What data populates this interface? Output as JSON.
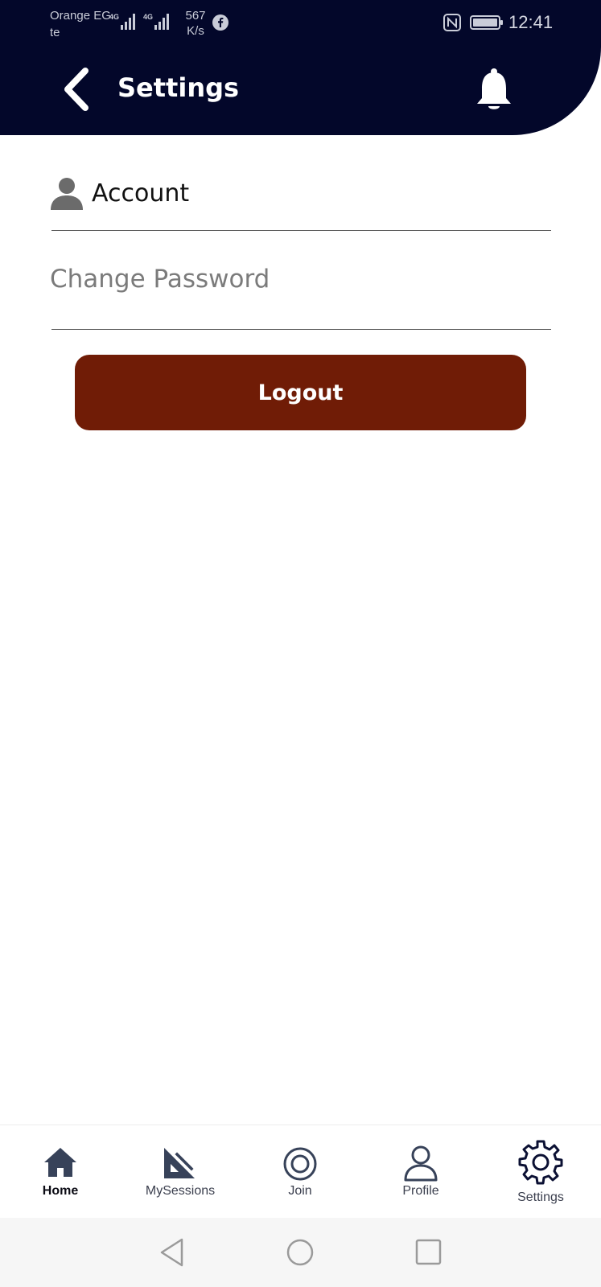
{
  "status_bar": {
    "carrier": "Orange EG te",
    "network_1": "4G",
    "network_2": "4G",
    "speed_value": "567",
    "speed_unit": "K/s",
    "time": "12:41"
  },
  "header": {
    "title": "Settings",
    "background_color": "#03072a",
    "back_icon": "chevron-left-icon",
    "bell_icon": "bell-icon"
  },
  "settings": {
    "account_label": "Account",
    "account_icon": "person-icon",
    "change_password_label": "Change Password",
    "logout_label": "Logout",
    "logout_color": "#701c06"
  },
  "bottom_nav": {
    "items": [
      {
        "label": "Home",
        "icon": "home-icon",
        "active": true
      },
      {
        "label": "MySessions",
        "icon": "set-square-icon",
        "active": false
      },
      {
        "label": "Join",
        "icon": "target-icon",
        "active": false
      },
      {
        "label": "Profile",
        "icon": "profile-icon",
        "active": false
      },
      {
        "label": "Settings",
        "icon": "gear-icon",
        "active": false
      }
    ]
  }
}
